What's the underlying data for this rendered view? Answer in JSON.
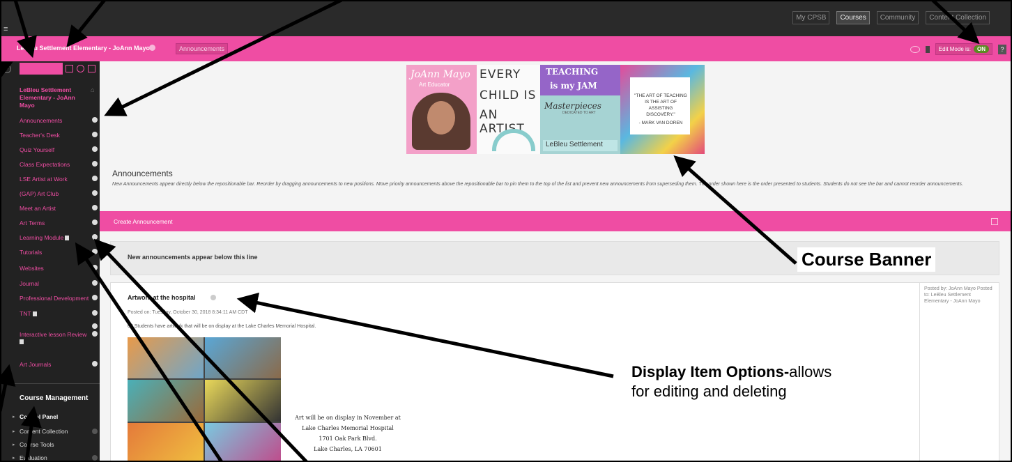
{
  "topnav": {
    "menu_glyph": "≡",
    "tabs": [
      "My CPSB",
      "Courses",
      "Community",
      "Content Collection"
    ]
  },
  "coursebar": {
    "course_title": "LeBleu Settlement Elementary - JoAnn Mayo",
    "breadcrumb": "Announcements",
    "edit_mode_label": "Edit Mode is:",
    "edit_mode_value": "ON",
    "help": "?"
  },
  "sidebar": {
    "header": "LeBleu Settlement Elementary - JoAnn Mayo",
    "items": [
      {
        "label": "Announcements"
      },
      {
        "label": "Teacher's Desk"
      },
      {
        "label": "Quiz Yourself"
      },
      {
        "label": "Class Expectations"
      },
      {
        "label": "LSE Artist at Work"
      },
      {
        "label": "(GAP) Art Club"
      },
      {
        "label": "Meet an Artist"
      },
      {
        "label": "Art Terms"
      },
      {
        "label": "Learning Module"
      },
      {
        "label": "Tutorials"
      },
      {
        "label": "Websites"
      },
      {
        "label": "Journal"
      },
      {
        "label": "Professional Development"
      },
      {
        "label": "TNT"
      },
      {
        "label": ""
      },
      {
        "label": "Interactive lesson Review"
      },
      {
        "label": "Art Journals"
      }
    ],
    "management": {
      "title": "Course Management",
      "items": [
        "Control Panel",
        "Content Collection",
        "Course Tools",
        "Evaluation"
      ]
    }
  },
  "banner": {
    "panel1_name": "JoAnn Mayo",
    "panel1_role": "Art Educator",
    "panel2_lines": [
      "EVERY",
      "CHILD IS",
      "AN ARTIST"
    ],
    "panel3_top1": "TEACHING",
    "panel3_top2": "is my JAM",
    "panel3_mid": "Masterpieces",
    "panel3_midsub": "DEDICATED TO ART",
    "panel3_bottom": "LeBleu Settlement",
    "panel4_quote": "\"THE ART OF TEACHING IS THE ART OF ASSISTING DISCOVERY.\"",
    "panel4_author": "- MARK VAN DOREN"
  },
  "main": {
    "title": "Announcements",
    "description": "New Announcements appear directly below the repositionable bar. Reorder by dragging announcements to new positions. Move priority announcements above the repositionable bar to pin them to the top of the list and prevent new announcements from superseding them. The order shown here is the order presented to students. Students do not see the bar and cannot reorder announcements.",
    "create_button": "Create Announcement",
    "divider_text": "New announcements appear below this line",
    "announcement": {
      "title": "Artwork at the hospital",
      "posted_on": "Posted on: Tuesday, October 30, 2018 8:34:11 AM CDT",
      "body": "60 Students have artwork that will be on display at the Lake Charles Memorial Hospital.",
      "side_info": "Posted by: JoAnn Mayo Posted to: LeBleu Settlement Elementary - JoAnn Mayo",
      "caption_lines": [
        "Art will be on display in November at",
        "Lake Charles Memorial Hospital",
        "1701 Oak Park Blvd.",
        "Lake Charles, LA 70601"
      ]
    }
  },
  "callouts": {
    "course_banner": "Course Banner",
    "display_options_bold": "Display Item Options-",
    "display_options_rest": "allows",
    "display_options_line2": "for editing and deleting"
  },
  "colors": {
    "accent_pink": "#ef4da3",
    "nav_dark": "#2a2a2a",
    "sidebar_dark": "#222222",
    "edit_on_green": "#5c8a22"
  }
}
